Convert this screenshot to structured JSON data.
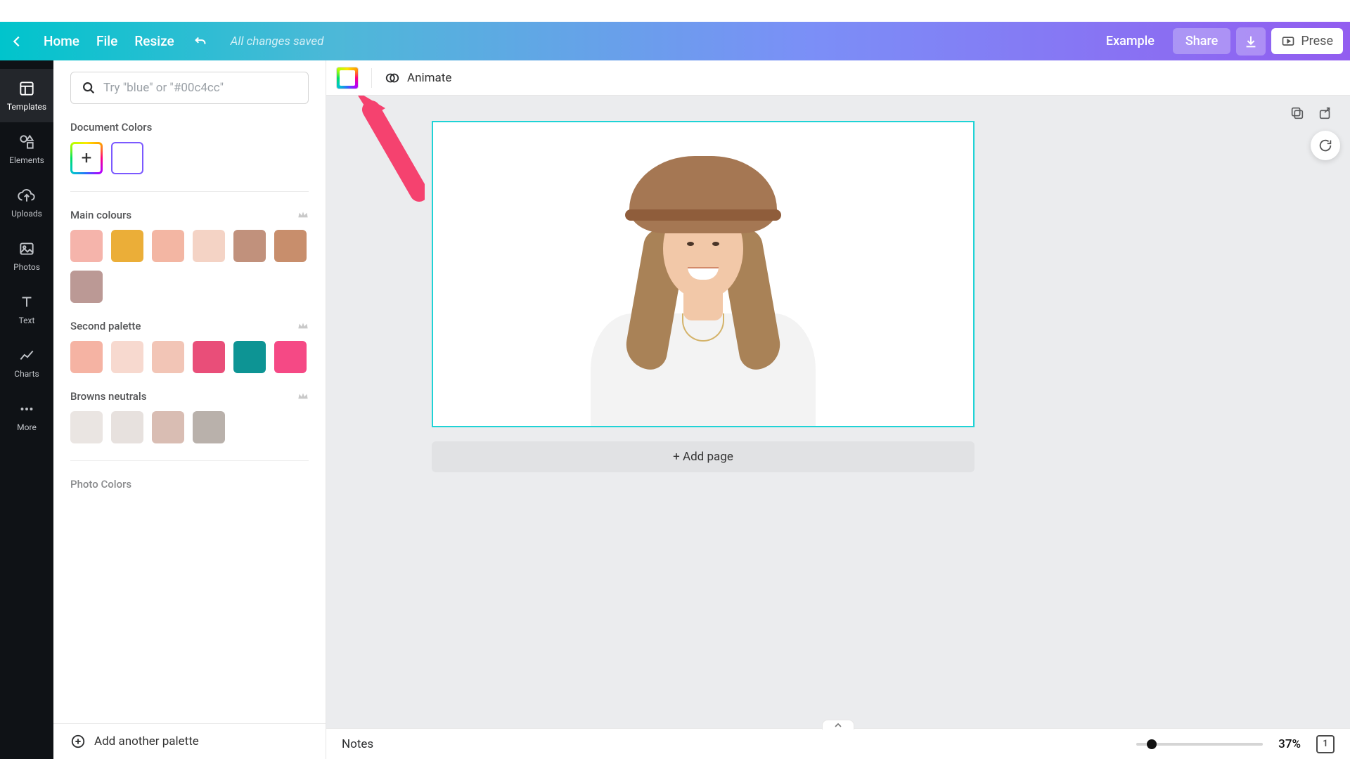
{
  "header": {
    "home": "Home",
    "file": "File",
    "resize": "Resize",
    "save_status": "All changes saved",
    "example": "Example",
    "share": "Share",
    "present": "Prese"
  },
  "nav": {
    "templates": "Templates",
    "elements": "Elements",
    "uploads": "Uploads",
    "photos": "Photos",
    "text": "Text",
    "charts": "Charts",
    "more": "More"
  },
  "panel": {
    "search_placeholder": "Try \"blue\" or \"#00c4cc\"",
    "document_colors": "Document Colors",
    "main_colours": "Main colours",
    "second_palette": "Second palette",
    "browns_neutrals": "Browns neutrals",
    "photo_colors": "Photo Colors",
    "add_palette": "Add another palette"
  },
  "colors": {
    "main": [
      "#f5b4ab",
      "#ebae38",
      "#f3b6a3",
      "#f4d3c5",
      "#c1917c",
      "#c88e6c",
      "#bb9995"
    ],
    "second": [
      "#f5b3a3",
      "#f7d9cf",
      "#f2c5b6",
      "#e94e79",
      "#0d9494",
      "#f54985"
    ],
    "browns": [
      "#eae5e2",
      "#e7e1de",
      "#d9bdb3",
      "#b9b1ab"
    ]
  },
  "toolbar": {
    "animate": "Animate"
  },
  "canvas": {
    "add_page": "+ Add page"
  },
  "footer": {
    "notes": "Notes",
    "zoom": "37%",
    "page": "1"
  }
}
